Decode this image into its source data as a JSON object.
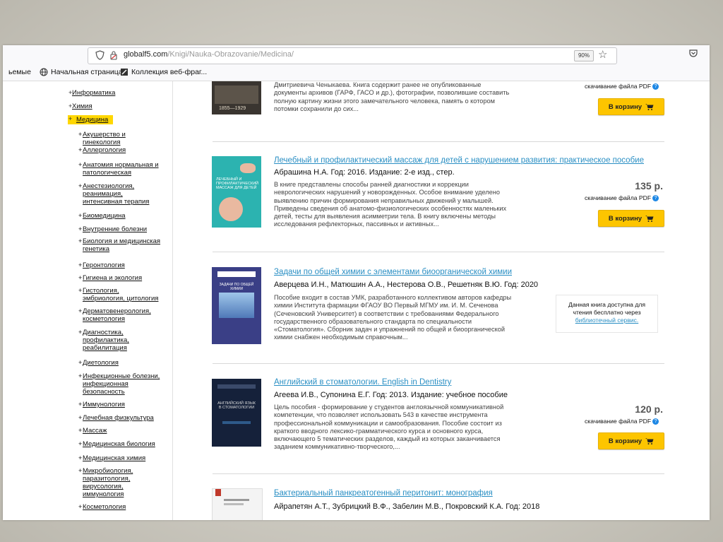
{
  "browser": {
    "url_host": "globalf5.com",
    "url_path": "/Knigi/Nauka-Obrazovanie/Medicina/",
    "zoom": "90%",
    "bookmarks": [
      {
        "label": "ьемые",
        "icon": "none"
      },
      {
        "label": "Начальная страница",
        "icon": "globe-icon"
      },
      {
        "label": "Коллекция веб-фраг...",
        "icon": "web-slice-icon"
      }
    ]
  },
  "sidebar": {
    "categories": [
      {
        "label": "Информатика",
        "selected": false
      },
      {
        "label": "Химия",
        "selected": false
      },
      {
        "label": "Медицина",
        "selected": true
      }
    ],
    "subcategories": [
      {
        "lines": [
          "Акушерство и",
          "гинекология"
        ]
      },
      {
        "lines": [
          "Аллергология"
        ]
      },
      {
        "lines": [
          "Анатомия нормальная и",
          "патологическая"
        ]
      },
      {
        "lines": [
          "Анестезиология,",
          "реанимация,",
          "интенсивная терапия"
        ]
      },
      {
        "lines": [
          "Биомедицина"
        ]
      },
      {
        "lines": [
          "Внутренние болезни"
        ]
      },
      {
        "lines": [
          "Биология и медицинская",
          "генетика"
        ]
      },
      {
        "lines": [
          "Геронтология"
        ]
      },
      {
        "lines": [
          "Гигиена и экология"
        ]
      },
      {
        "lines": [
          "Гистология,",
          "эмбриология, цитология"
        ]
      },
      {
        "lines": [
          "Дерматовенерология,",
          "косметология"
        ]
      },
      {
        "lines": [
          "Диагностика,",
          "профилактика,",
          "реабилитация"
        ]
      },
      {
        "lines": [
          "Диетология"
        ]
      },
      {
        "lines": [
          "Инфекционные болезни,",
          "инфекционная",
          "безопасность"
        ]
      },
      {
        "lines": [
          "Иммунология"
        ]
      },
      {
        "lines": [
          "Лечебная физкультура"
        ]
      },
      {
        "lines": [
          "Массаж"
        ]
      },
      {
        "lines": [
          "Медицинская биология"
        ]
      },
      {
        "lines": [
          "Медицинская химия"
        ]
      },
      {
        "lines": [
          "Микробиология,",
          "паразитология,",
          "вирусология,",
          "иммунология"
        ]
      },
      {
        "lines": [
          "Косметология"
        ]
      }
    ]
  },
  "listings": [
    {
      "title": "",
      "authors": "",
      "description": [
        "Дмитриевича Ченыкаева. Книга содержит ранее не опубликованные",
        "документы архивов (ГАРФ, ГАСО и др.), фотографии, позволившие составить",
        "полную картину жизни этого замечательного человека, память о котором",
        "потомки сохранили до сих..."
      ],
      "price": "",
      "pdf_label": "скачивание файла PDF",
      "cart_label": "В корзину",
      "cover_text": "1855—1929"
    },
    {
      "title": "Лечебный и профилактический массаж для детей с нарушением развития: практическое пособие",
      "authors": "Абрашина Н.А. Год: 2016. Издание: 2-е изд., стер.",
      "description": [
        "В книге представлены способы ранней диагностики и коррекции",
        "неврологических нарушений у новорожденных. Особое внимание уделено",
        "выявлению причин формирования неправильных движений у малышей.",
        "Приведены сведения об анатомо-физиологических особенностях маленьких",
        "детей, тесты для выявления асимметрии тела. В книгу включены методы",
        "исследования рефлекторных, пассивных и активных..."
      ],
      "price": "135 р.",
      "pdf_label": "скачивание файла PDF",
      "cart_label": "В корзину",
      "cover_text": "ЛЕЧЕБНЫЙ И ПРОФИЛАКТИЧЕСКИЙ МАССАЖ ДЛЯ ДЕТЕЙ"
    },
    {
      "title": "Задачи по общей химии с элементами биоорганической химии",
      "authors": "Аверцева И.Н., Матюшин А.А., Нестерова О.В., Решетняк В.Ю. Год: 2020",
      "description": [
        "Пособие входит в состав УМК, разработанного коллективом авторов кафедры",
        "химии Института фармации ФГАОУ ВО Первый МГМУ им. И. М. Сеченова",
        "(Сеченовский Университет) в соответствии с требованиями Федерального",
        "государственного образовательного стандарта по специальности",
        "«Стоматология». Сборник задач и упражнений по общей и биоорганической",
        "химии снабжен необходимым справочным..."
      ],
      "free_note": [
        "Данная книга доступна для",
        "чтения бесплатно через"
      ],
      "free_link": "библиотечный сервис.",
      "cover_text": "ЗАДАЧИ ПО ОБЩЕЙ ХИМИИ"
    },
    {
      "title": "Английский в стоматологии. English in Dentistry",
      "authors": "Агеева И.В., Супонина Е.Г. Год: 2013. Издание: учебное пособие",
      "description": [
        "Цель пособия - формирование у студентов англоязычной коммуникативной",
        "компетенции, что позволяет использовать 543 в качестве инструмента",
        "профессиональной коммуникации и самообразования. Пособие состоит из",
        "краткого вводного лексико-грамматического курса и основного курса,",
        "включающего 5 тематических разделов, каждый из которых заканчивается",
        "заданием коммуникативно-творческого,..."
      ],
      "price": "120 р.",
      "pdf_label": "скачивание файла PDF",
      "cart_label": "В корзину",
      "cover_text": "АНГЛИЙСКИЙ ЯЗЫК В СТОМАТОЛОГИИ"
    },
    {
      "title": "Бактериальный панкреатогенный перитонит: монография",
      "authors": "Айрапетян А.Т., Зубрицкий В.Ф., Забелин М.В., Покровский К.А. Год: 2018",
      "description": []
    }
  ]
}
